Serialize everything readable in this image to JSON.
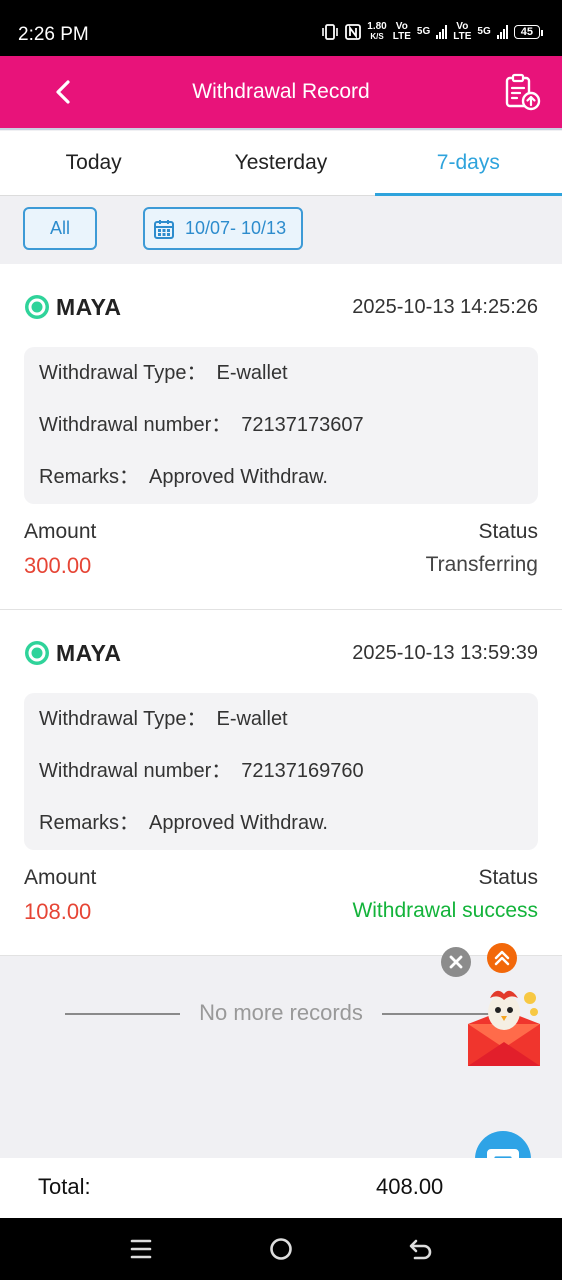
{
  "status_bar": {
    "time": "2:26 PM",
    "net_speed": "1.80",
    "net_unit": "K/S",
    "vo1": "Vo",
    "lte1": "LTE",
    "g1": "5G",
    "vo2": "Vo",
    "lte2": "LTE",
    "g2": "5G",
    "battery": "45"
  },
  "header": {
    "title": "Withdrawal Record",
    "back_icon": "chevron-left-icon",
    "doc_icon": "clipboard-upload-icon",
    "color": "#e8137a"
  },
  "tabs": [
    {
      "label": "Today",
      "active": false
    },
    {
      "label": "Yesterday",
      "active": false
    },
    {
      "label": "7-days",
      "active": true
    }
  ],
  "filters": {
    "all_label": "All",
    "date_range": "10/07- 10/13",
    "date_icon": "calendar-icon"
  },
  "records": [
    {
      "brand": "MAYA",
      "datetime": "2025-10-13 14:25:26",
      "type_label": "Withdrawal Type：",
      "type_value": "E-wallet",
      "number_label": "Withdrawal number：",
      "number_value": "72137173607",
      "remarks_label": "Remarks：",
      "remarks_value": "Approved Withdraw.",
      "amount_label": "Amount",
      "amount": "300.00",
      "status_label": "Status",
      "status": "Transferring"
    },
    {
      "brand": "MAYA",
      "datetime": "2025-10-13 13:59:39",
      "type_label": "Withdrawal Type：",
      "type_value": "E-wallet",
      "number_label": "Withdrawal number：",
      "number_value": "72137169760",
      "remarks_label": "Remarks：",
      "remarks_value": "Approved Withdraw.",
      "amount_label": "Amount",
      "amount": "108.00",
      "status_label": "Status",
      "status": "Withdrawal success"
    }
  ],
  "no_more": "No more records",
  "total": {
    "label": "Total:",
    "value": "408.00"
  },
  "colors": {
    "accent": "#2ea3dc",
    "amount": "#e64535",
    "success": "#13b33a"
  }
}
